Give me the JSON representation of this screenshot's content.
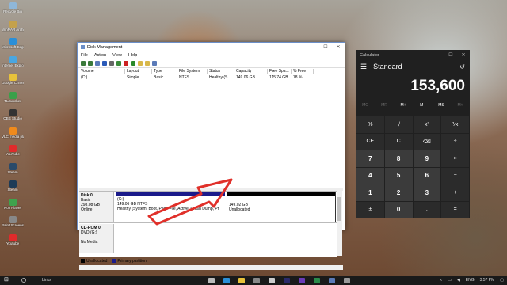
{
  "desktop": {
    "icons": [
      {
        "label": "Recycle Bin",
        "color": "#8fb7d9"
      },
      {
        "label": "WinRAR Archive",
        "color": "#c4a14c"
      },
      {
        "label": "Microsoft Edge",
        "color": "#2a8fd8"
      },
      {
        "label": "Internet Explorer",
        "color": "#4aa6e0"
      },
      {
        "label": "Google Chrome",
        "color": "#e8c23a"
      },
      {
        "label": "TLauncher",
        "color": "#3aa04a"
      },
      {
        "label": "OBS Studio",
        "color": "#333333"
      },
      {
        "label": "VLC media player",
        "color": "#f08a1c"
      },
      {
        "label": "YouTube",
        "color": "#e02b2b"
      },
      {
        "label": "Steam",
        "color": "#2a4a6a"
      },
      {
        "label": "Steam",
        "color": "#1d3b57"
      },
      {
        "label": "Nox Player",
        "color": "#3fa34d"
      },
      {
        "label": "Paint Screenshots",
        "color": "#888888"
      },
      {
        "label": "Youtube",
        "color": "#e02b2b"
      }
    ]
  },
  "disk_management": {
    "title": "Disk Management",
    "window_buttons": [
      "—",
      "☐",
      "✕"
    ],
    "menu": [
      "File",
      "Action",
      "View",
      "Help"
    ],
    "toolbar_icons": [
      {
        "name": "back-icon",
        "color": "#3a7a3a"
      },
      {
        "name": "forward-icon",
        "color": "#3a7a3a"
      },
      {
        "name": "properties-icon",
        "color": "#5a7ab8"
      },
      {
        "name": "help-icon",
        "color": "#2a5ab8"
      },
      {
        "name": "list-icon",
        "color": "#666666"
      },
      {
        "name": "connect-icon",
        "color": "#3a8a3a"
      },
      {
        "name": "delete-icon",
        "color": "#cc2222"
      },
      {
        "name": "check-icon",
        "color": "#2a8a2a"
      },
      {
        "name": "folder-icon",
        "color": "#d8b84a"
      },
      {
        "name": "open-icon",
        "color": "#d8b84a"
      },
      {
        "name": "view-icon",
        "color": "#5a7ab8"
      }
    ],
    "volume_table": {
      "headers": [
        "Volume",
        "Layout",
        "Type",
        "File System",
        "Status",
        "Capacity",
        "Free Spa...",
        "% Free"
      ],
      "rows": [
        [
          "(C:)",
          "Simple",
          "Basic",
          "NTFS",
          "Healthy (S...",
          "149.06 GB",
          "115.74 GB",
          "78 %"
        ]
      ]
    },
    "disks": [
      {
        "name": "Disk 0",
        "type": "Basic",
        "size": "298.08 GB",
        "status": "Online",
        "partitions": [
          {
            "title": "(C:)",
            "size": "149.06 GB NTFS",
            "status": "Healthy (System, Boot, Page File, Active, Crash Dump, Pr",
            "bar_color": "#1a1a8a"
          },
          {
            "title": "",
            "size": "149.02 GB",
            "status": "Unallocated",
            "bar_color": "#000000"
          }
        ]
      },
      {
        "name": "CD-ROM 0",
        "type": "DVD (G:)",
        "size": "",
        "status": "No Media",
        "partitions": []
      }
    ],
    "legend": [
      {
        "label": "Unallocated",
        "color": "#000000"
      },
      {
        "label": "Primary partition",
        "color": "#1a1a8a"
      }
    ]
  },
  "calculator": {
    "title": "Calculator",
    "window_buttons": [
      "—",
      "☐",
      "✕"
    ],
    "mode": "Standard",
    "display": "153,600",
    "memory_buttons": [
      {
        "label": "MC",
        "enabled": false
      },
      {
        "label": "MR",
        "enabled": false
      },
      {
        "label": "M+",
        "enabled": true
      },
      {
        "label": "M-",
        "enabled": true
      },
      {
        "label": "MS",
        "enabled": true
      },
      {
        "label": "M˅",
        "enabled": false
      }
    ],
    "keys": [
      {
        "label": "%",
        "num": false
      },
      {
        "label": "√",
        "num": false
      },
      {
        "label": "x²",
        "num": false
      },
      {
        "label": "⅟x",
        "num": false
      },
      {
        "label": "CE",
        "num": false
      },
      {
        "label": "C",
        "num": false
      },
      {
        "label": "⌫",
        "num": false
      },
      {
        "label": "÷",
        "num": false
      },
      {
        "label": "7",
        "num": true
      },
      {
        "label": "8",
        "num": true
      },
      {
        "label": "9",
        "num": true
      },
      {
        "label": "×",
        "num": false
      },
      {
        "label": "4",
        "num": true
      },
      {
        "label": "5",
        "num": true
      },
      {
        "label": "6",
        "num": true
      },
      {
        "label": "−",
        "num": false
      },
      {
        "label": "1",
        "num": true
      },
      {
        "label": "2",
        "num": true
      },
      {
        "label": "3",
        "num": true
      },
      {
        "label": "+",
        "num": false
      },
      {
        "label": "±",
        "num": false
      },
      {
        "label": "0",
        "num": true
      },
      {
        "label": ".",
        "num": false
      },
      {
        "label": "=",
        "num": false
      }
    ]
  },
  "taskbar": {
    "start": "⊞",
    "links_label": "Links",
    "apps": [
      {
        "name": "task-view",
        "color": "#bbbbbb"
      },
      {
        "name": "edge",
        "color": "#2a8fd8"
      },
      {
        "name": "file-explorer",
        "color": "#e8c23a"
      },
      {
        "name": "store",
        "color": "#888888"
      },
      {
        "name": "mail",
        "color": "#cccccc"
      },
      {
        "name": "premiere",
        "color": "#2a2a6a"
      },
      {
        "name": "visual-studio",
        "color": "#6a3ab8"
      },
      {
        "name": "excel",
        "color": "#2a8a4a"
      },
      {
        "name": "disk-management",
        "color": "#5a7ab8"
      },
      {
        "name": "calculator",
        "color": "#999999"
      }
    ],
    "tray": [
      "∧",
      "▭",
      "◀",
      "ENG",
      "3:57 PM",
      "▢"
    ]
  }
}
